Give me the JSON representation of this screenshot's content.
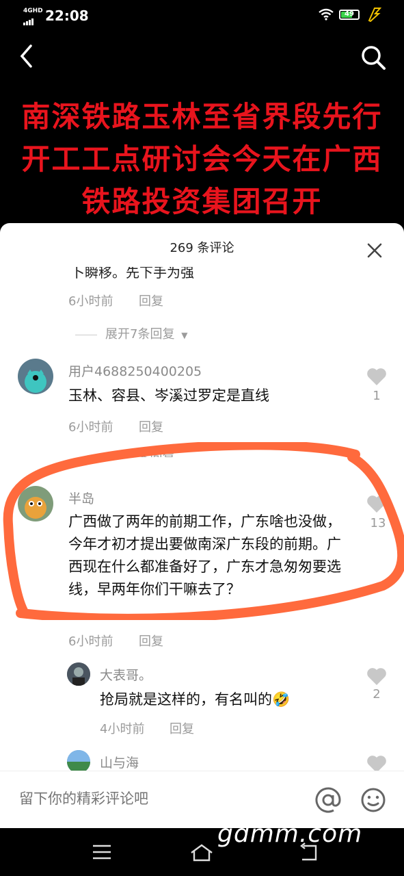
{
  "status": {
    "network": "4GHD",
    "time": "22:08",
    "battery": "49"
  },
  "video": {
    "title": "南深铁路玉林至省界段先行开工工点研讨会今天在广西铁路投资集团召开"
  },
  "sheet": {
    "title": "269 条评论",
    "cut_text": "卜瞬移。先下手为强",
    "first_meta": {
      "time": "6小时前",
      "reply": "回复"
    },
    "first_expand": "展开7条回复",
    "comments": [
      {
        "user": "用户4688250400205",
        "text": "玉林、容县、岑溪过罗定是直线",
        "time": "6小时前",
        "reply": "回复",
        "likes": "1",
        "expand": "展开1条回复"
      },
      {
        "user": "半岛",
        "text": "广西做了两年的前期工作，广东啥也没做，今年才初才提出要做南深广东段的前期。广西现在什么都准备好了，广东才急匆匆要选线，早两年你们干嘛去了？",
        "time": "6小时前",
        "reply": "回复",
        "likes": "13"
      }
    ],
    "replies": [
      {
        "user": "大表哥。",
        "text": "抢局就是这样的，有名叫的",
        "emoji": "🤣",
        "time": "4小时前",
        "reply": "回复",
        "likes": "2"
      },
      {
        "user": "山与海"
      }
    ]
  },
  "input": {
    "placeholder": "留下你的精彩评论吧"
  },
  "watermark": "gdmm.com",
  "colors": {
    "title_red": "#e8141d",
    "annotation": "#ff6a3d"
  }
}
